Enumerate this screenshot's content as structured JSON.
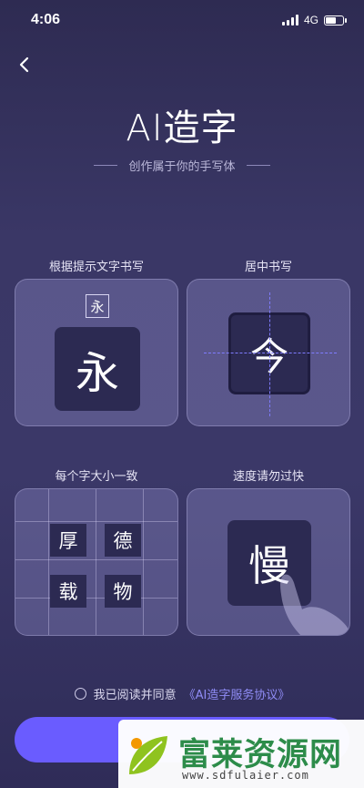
{
  "status_bar": {
    "time": "4:06",
    "network": "4G"
  },
  "header": {
    "title": "AI造字",
    "subtitle": "创作属于你的手写体"
  },
  "tips": [
    {
      "caption": "根据提示文字书写",
      "hint_char": "永",
      "main_char": "永"
    },
    {
      "caption": "居中书写",
      "main_char": "今"
    },
    {
      "caption": "每个字大小一致",
      "grid_chars": [
        "厚",
        "德",
        "载",
        "物"
      ]
    },
    {
      "caption": "速度请勿过快",
      "main_char": "慢"
    }
  ],
  "agreement": {
    "text": "我已阅读并同意",
    "link": "《AI造字服务协议》"
  },
  "watermark": {
    "brand": "富莱资源网",
    "url": "www.sdfulaier.com"
  },
  "colors": {
    "accent": "#6a5cff",
    "link": "#8f8cf5",
    "card_bg": "#2c2a52"
  }
}
